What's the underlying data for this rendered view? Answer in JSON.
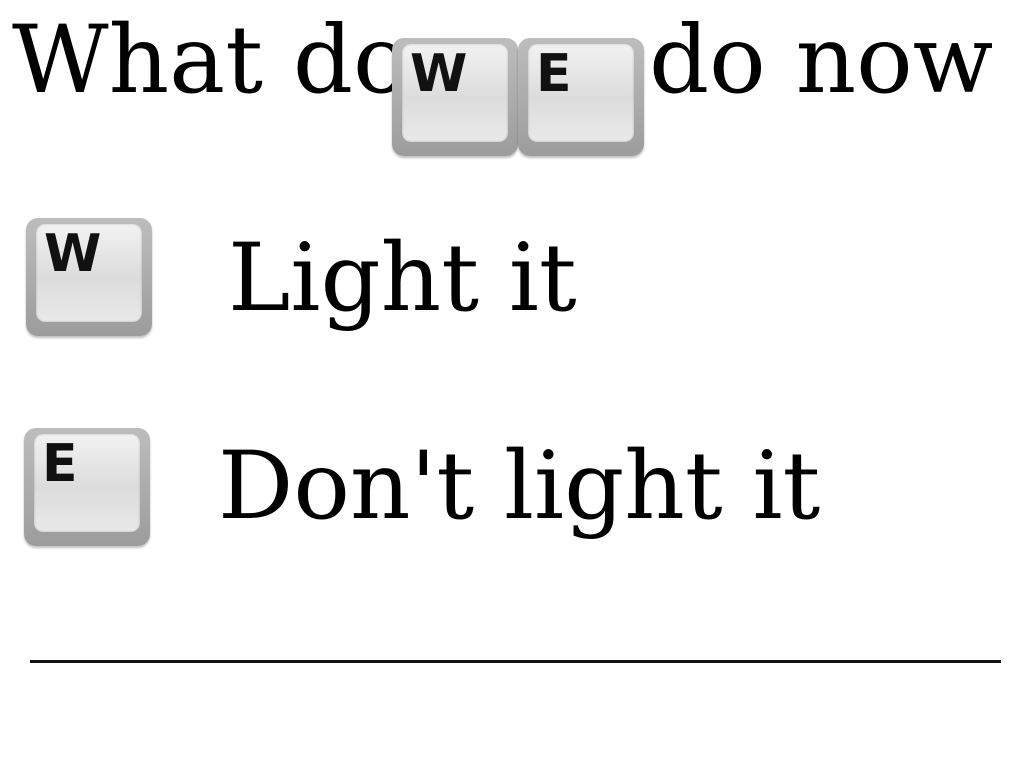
{
  "question": {
    "before": "What do",
    "key_1": "W",
    "key_2": "E",
    "after": "do now ?"
  },
  "options": [
    {
      "key": "W",
      "label": "Light it"
    },
    {
      "key": "E",
      "label": "Don't light it"
    }
  ]
}
